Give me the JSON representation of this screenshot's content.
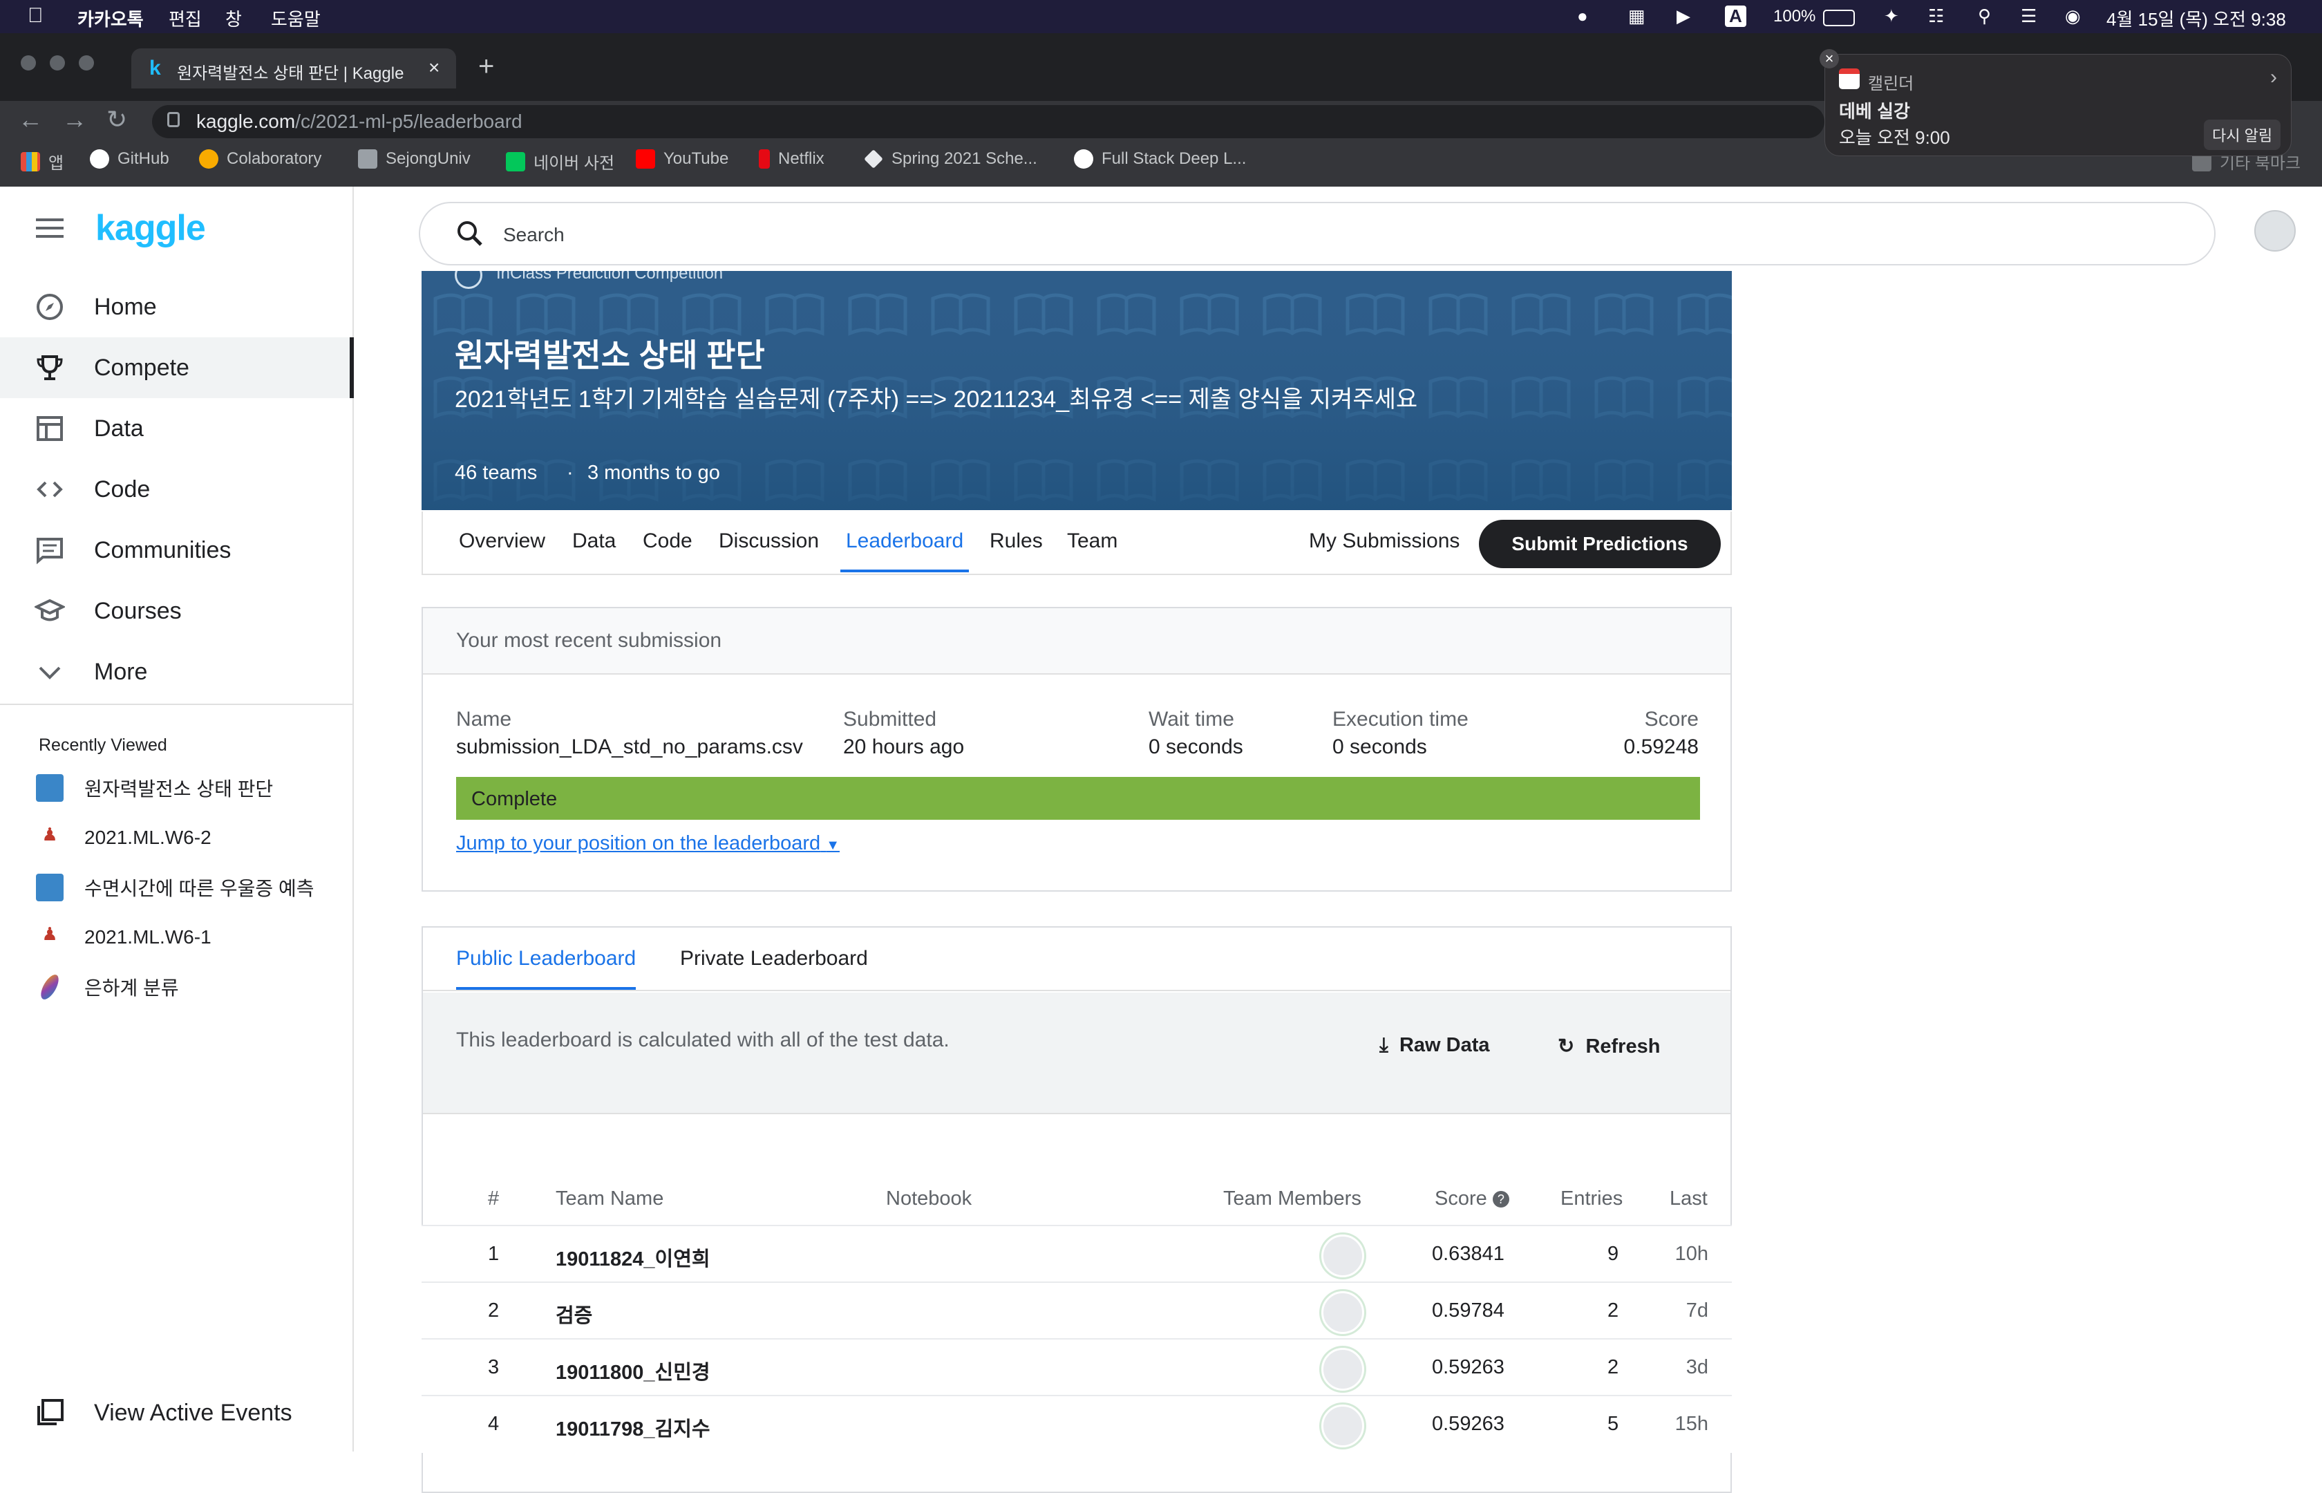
{
  "menubar": {
    "app": "카카오톡",
    "items": [
      "편집",
      "창",
      "도움말"
    ],
    "battery": "100%",
    "datetime": "4월 15일 (목) 오전 9:38"
  },
  "browser": {
    "tab_title": "원자력발전소 상태 판단 | Kaggle",
    "url_host": "kaggle.com",
    "url_path": "/c/2021-ml-p5/leaderboard",
    "bookmarks": [
      "앱",
      "GitHub",
      "Colaboratory",
      "SejongUniv",
      "네이버 사전",
      "YouTube",
      "Netflix",
      "Spring 2021 Sche...",
      "Full Stack Deep L..."
    ],
    "bookmarks_other": "기타 북마크"
  },
  "notification": {
    "app": "캘린더",
    "title": "데베 실강",
    "time": "오늘 오전 9:00",
    "action": "다시 알림"
  },
  "kaggle": {
    "logo": "kaggle",
    "search_placeholder": "Search",
    "nav": [
      "Home",
      "Compete",
      "Data",
      "Code",
      "Communities",
      "Courses",
      "More"
    ],
    "recently_viewed_title": "Recently Viewed",
    "recent": [
      "원자력발전소 상태 판단",
      "2021.ML.W6-2",
      "수면시간에 따른 우울증 예측",
      "2021.ML.W6-1",
      "은하계 분류"
    ],
    "view_active_events": "View Active Events"
  },
  "competition": {
    "kind": "InClass Prediction Competition",
    "title": "원자력발전소 상태 판단",
    "subtitle": "2021학년도 1학기 기계학습 실습문제 (7주차) ==> 20211234_최유경 <== 제출 양식을 지켜주세요",
    "teams": "46 teams",
    "deadline": "3 months to go",
    "tabs": [
      "Overview",
      "Data",
      "Code",
      "Discussion",
      "Leaderboard",
      "Rules",
      "Team"
    ],
    "my_submissions": "My Submissions",
    "submit": "Submit Predictions"
  },
  "submission": {
    "header": "Your most recent submission",
    "name_label": "Name",
    "name": "submission_LDA_std_no_params.csv",
    "submitted_label": "Submitted",
    "submitted": "20 hours ago",
    "wait_label": "Wait time",
    "wait": "0 seconds",
    "exec_label": "Execution time",
    "exec": "0 seconds",
    "score_label": "Score",
    "score": "0.59248",
    "status": "Complete",
    "jump": "Jump to your position on the leaderboard"
  },
  "leaderboard": {
    "tabs": [
      "Public Leaderboard",
      "Private Leaderboard"
    ],
    "note": "This leaderboard is calculated with all of the test data.",
    "raw_data": "Raw Data",
    "refresh": "Refresh",
    "columns": [
      "#",
      "Team Name",
      "Notebook",
      "Team Members",
      "Score",
      "Entries",
      "Last"
    ],
    "rows": [
      {
        "rank": "1",
        "team": "19011824_이연희",
        "score": "0.63841",
        "entries": "9",
        "last": "10h"
      },
      {
        "rank": "2",
        "team": "검증",
        "score": "0.59784",
        "entries": "2",
        "last": "7d"
      },
      {
        "rank": "3",
        "team": "19011800_신민경",
        "score": "0.59263",
        "entries": "2",
        "last": "3d"
      },
      {
        "rank": "4",
        "team": "19011798_김지수",
        "score": "0.59263",
        "entries": "5",
        "last": "15h"
      }
    ]
  },
  "colors": {
    "kaggle_blue": "#20beff",
    "link_blue": "#1a73e8",
    "complete_green": "#7cb342",
    "banner_blue": "#2e5d8a"
  }
}
